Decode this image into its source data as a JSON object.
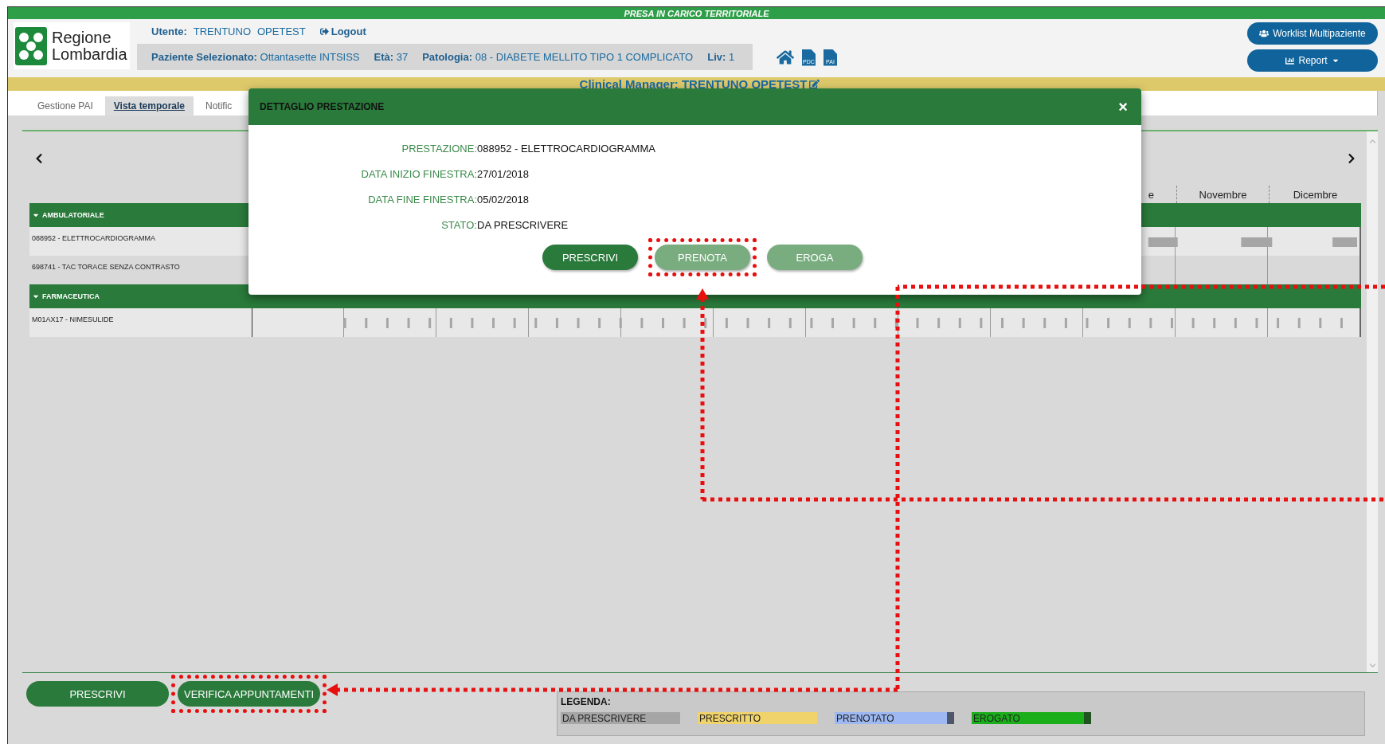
{
  "banner": {
    "title": "PRESA IN CARICO TERRITORIALE"
  },
  "logo": {
    "line1": "Regione",
    "line2": "Lombardia"
  },
  "user": {
    "label": "Utente:",
    "first_name": "TRENTUNO",
    "last_name": "OPETEST",
    "logout": "Logout"
  },
  "patient": {
    "fields": [
      {
        "label": "Paziente Selezionato:",
        "value": "Ottantasette INTSISS"
      },
      {
        "label": "Età:",
        "value": "37"
      },
      {
        "label": "Patologia:",
        "value": "08 - DIABETE MELLITO TIPO 1 COMPLICATO"
      },
      {
        "label": "Liv:",
        "value": "1"
      }
    ]
  },
  "doc_icons": [
    {
      "label": "PDC"
    },
    {
      "label": "PAI"
    }
  ],
  "header_buttons": [
    {
      "label": "Worklist Multipaziente",
      "kind": "worklist"
    },
    {
      "label": "Report",
      "kind": "report"
    }
  ],
  "manager": {
    "text": "Clinical Manager: TRENTUNO OPETEST"
  },
  "tabs": [
    {
      "label": "Gestione PAI",
      "selected": false
    },
    {
      "label": "Vista temporale",
      "selected": true
    },
    {
      "label": "Notific",
      "selected": false
    }
  ],
  "timeline": {
    "months": [
      "e",
      "Novembre",
      "Dicembre"
    ],
    "groups": [
      {
        "name": "AMBULATORIALE",
        "expanded": true,
        "rows": [
          {
            "label": "088952 - ELETTROCARDIOGRAMMA",
            "kind": "bars"
          },
          {
            "label": "698741 - TAC TORACE SENZA CONTRASTO",
            "kind": "empty"
          }
        ]
      },
      {
        "name": "FARMACEUTICA",
        "expanded": true,
        "rows": [
          {
            "label": "M01AX17 - NIMESULIDE",
            "kind": "ticks"
          }
        ]
      }
    ]
  },
  "actions": [
    {
      "label": "PRESCRIVI",
      "highlighted": false
    },
    {
      "label": "VERIFICA APPUNTAMENTI",
      "highlighted": true
    }
  ],
  "legend": {
    "title": "LEGENDA:",
    "items": [
      {
        "label": "DA PRESCRIVERE",
        "color": "#a6a6a6",
        "end_marker": false
      },
      {
        "label": "PRESCRITTO",
        "color": "#f0d36b",
        "end_marker": false
      },
      {
        "label": "PRENOTATO",
        "color": "#9db8f2",
        "end_marker": true
      },
      {
        "label": "EROGATO",
        "color": "#1aaf1a",
        "end_marker": true
      }
    ]
  },
  "modal": {
    "title": "DETTAGLIO PRESTAZIONE",
    "close": "×",
    "fields": [
      {
        "label": "PRESTAZIONE:",
        "value": "088952 - ELETTROCARDIOGRAMMA"
      },
      {
        "label": "DATA INIZIO FINESTRA:",
        "value": "27/01/2018"
      },
      {
        "label": "DATA FINE FINESTRA:",
        "value": "05/02/2018"
      },
      {
        "label": "STATO:",
        "value": "DA PRESCRIVERE"
      }
    ],
    "buttons": [
      {
        "label": "PRESCRIVI",
        "disabled": false,
        "highlighted": false
      },
      {
        "label": "PRENOTA",
        "disabled": true,
        "highlighted": true
      },
      {
        "label": "EROGA",
        "disabled": true,
        "highlighted": false
      }
    ]
  }
}
